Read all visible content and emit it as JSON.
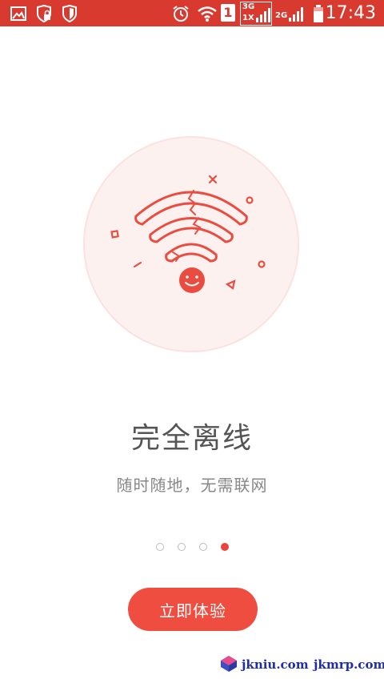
{
  "status_bar": {
    "time": "17:43",
    "sim_slot": "1",
    "network_primary": "3G",
    "network_primary_sub": "1X",
    "network_secondary": "2G",
    "icons": [
      "image-icon",
      "shield-lock-icon",
      "shield-icon",
      "alarm-icon",
      "wifi-icon",
      "sim-icon",
      "signal-icon",
      "battery-icon"
    ]
  },
  "onboarding": {
    "title": "完全离线",
    "subtitle": "随时随地，无需联网",
    "page_count": 4,
    "current_page": 4,
    "cta_label": "立即体验"
  },
  "colors": {
    "status_bar": "#d93a2f",
    "accent": "#e8453c",
    "circle_fill": "#fdf1f0"
  },
  "watermark": {
    "text_a": "jkniu.com",
    "text_b": "jkmrp.com"
  }
}
